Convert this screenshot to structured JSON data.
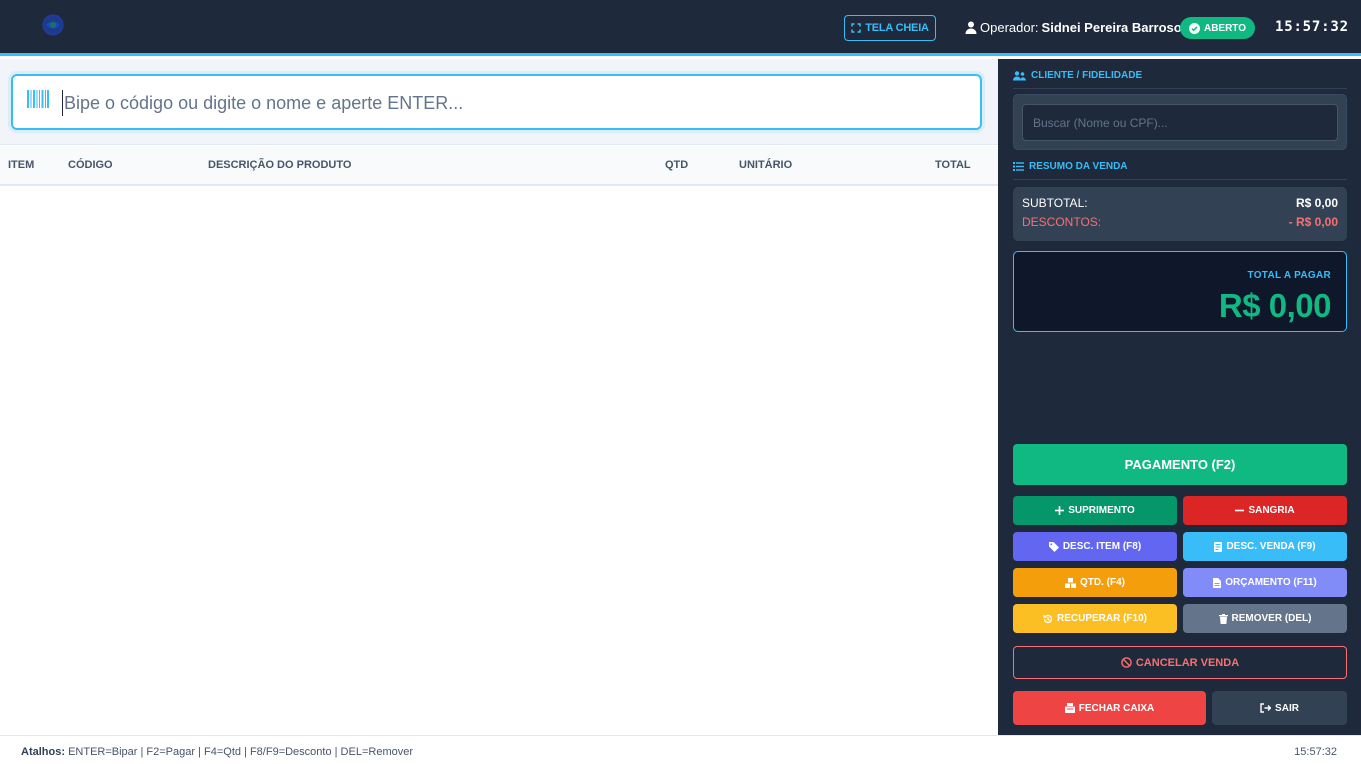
{
  "header": {
    "fullscreen_label": "TELA CHEIA",
    "operator_label": "Operador:",
    "operator_name": "Sidnei Pereira Barroso",
    "status": "ABERTO",
    "clock": "15:57:32"
  },
  "search": {
    "placeholder": "Bipe o código ou digite o nome e aperte ENTER..."
  },
  "table": {
    "columns": [
      "ITEM",
      "CÓDIGO",
      "DESCRIÇÃO DO PRODUTO",
      "QTD",
      "UNITÁRIO",
      "TOTAL"
    ],
    "rows": []
  },
  "client": {
    "title": "CLIENTE / FIDELIDADE",
    "placeholder": "Buscar (Nome ou CPF)..."
  },
  "summary": {
    "title": "RESUMO DA VENDA",
    "subtotal_label": "SUBTOTAL:",
    "subtotal_value": "R$ 0,00",
    "discount_label": "DESCONTOS:",
    "discount_value": "- R$ 0,00",
    "total_label": "TOTAL A PAGAR",
    "total_value": "R$ 0,00"
  },
  "actions": {
    "payment": "PAGAMENTO (F2)",
    "suprimento": "SUPRIMENTO",
    "sangria": "SANGRIA",
    "desc_item": "DESC. ITEM (F8)",
    "desc_venda": "DESC. VENDA (F9)",
    "qtd": "QTD. (F4)",
    "orcamento": "ORÇAMENTO (F11)",
    "recuperar": "RECUPERAR (F10)",
    "remover": "REMOVER (DEL)",
    "cancelar": "CANCELAR VENDA",
    "fechar_caixa": "FECHAR CAIXA",
    "sair": "SAIR"
  },
  "footer": {
    "shortcuts_label": "Atalhos:",
    "shortcuts_text": "ENTER=Bipar | F2=Pagar | F4=Qtd | F8/F9=Desconto | DEL=Remover",
    "clock": "15:57:32"
  },
  "colors": {
    "header_bg": "#1e293b",
    "accent": "#38bdf8",
    "success": "#10b981",
    "danger": "#dc2626",
    "indigo": "#6366f1",
    "amber": "#f59e0b"
  }
}
